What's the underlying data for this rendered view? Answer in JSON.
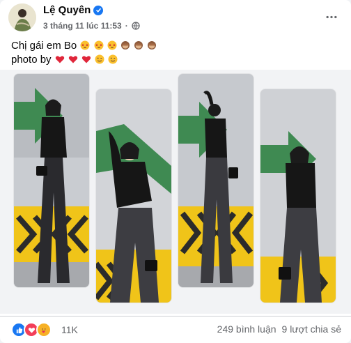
{
  "post": {
    "author": "Lệ Quyên",
    "timestamp": "3 tháng 11 lúc 11:53",
    "separator": "·",
    "caption_line1": "Chị gái em Bo",
    "caption_line2": "photo by",
    "caption_line1_emojis": [
      "star-struck-icon",
      "star-struck-icon",
      "star-struck-icon",
      "see-no-evil-monkey-icon",
      "see-no-evil-monkey-icon",
      "see-no-evil-monkey-icon"
    ],
    "caption_line2_emojis": [
      "red-heart-icon",
      "red-heart-icon",
      "red-heart-icon",
      "winking-face-icon",
      "winking-face-icon"
    ]
  },
  "photos": [
    {
      "pose": "standing-front"
    },
    {
      "pose": "arm-raised-crop"
    },
    {
      "pose": "back-view"
    },
    {
      "pose": "side-lean"
    }
  ],
  "footer": {
    "reactions_count": "11K",
    "comments": "249 bình luận",
    "shares": "9 lượt chia sẻ",
    "reaction_icons": [
      "like-icon",
      "love-icon",
      "care-icon"
    ]
  },
  "colors": {
    "fb_blue": "#1877f2",
    "love_red": "#f33e58",
    "care_yellow": "#f7b125",
    "secondary_text": "#65676b"
  }
}
